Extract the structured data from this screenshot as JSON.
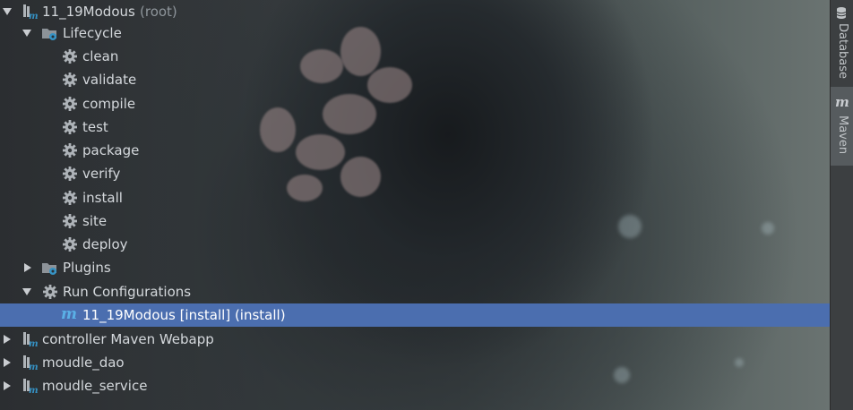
{
  "tree": {
    "root": {
      "name": "11_19Modous",
      "suffix": "(root)"
    },
    "lifecycle": {
      "label": "Lifecycle",
      "phases": [
        "clean",
        "validate",
        "compile",
        "test",
        "package",
        "verify",
        "install",
        "site",
        "deploy"
      ]
    },
    "plugins": {
      "label": "Plugins"
    },
    "run_configurations": {
      "label": "Run Configurations",
      "items": [
        "11_19Modous [install] (install)"
      ]
    },
    "modules": [
      "controller Maven Webapp",
      "moudle_dao",
      "moudle_service"
    ]
  },
  "tool_strip": {
    "database_label": "Database",
    "maven_label": "Maven",
    "maven_logo": "m"
  },
  "colors": {
    "selection": "#4b6eaf",
    "maven_blue": "#3592c4",
    "gear": "#aeb3b8",
    "text": "#d4d8dc"
  }
}
